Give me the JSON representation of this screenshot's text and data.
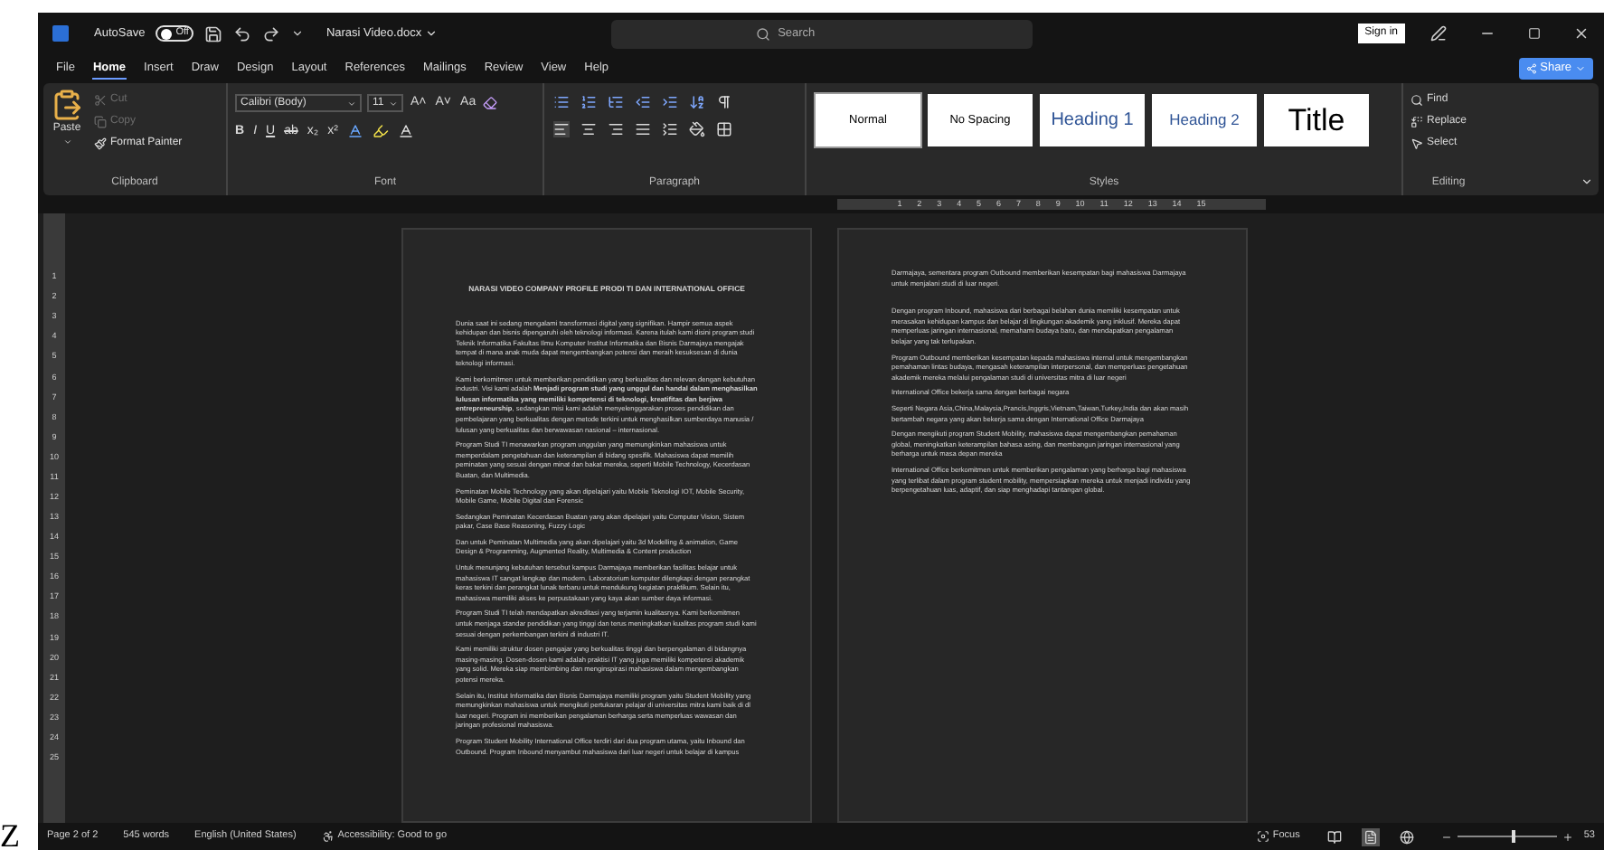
{
  "edge_fragment": "Z",
  "title_bar": {
    "autosave_label": "AutoSave",
    "autosave": {
      "on": false,
      "label": "Off"
    },
    "document_title": "Narasi Video.docx",
    "search": {
      "placeholder": "Search"
    },
    "sign_in": "Sign in"
  },
  "tabs": [
    {
      "label": "File",
      "selected": false
    },
    {
      "label": "Home",
      "selected": true
    },
    {
      "label": "Insert",
      "selected": false
    },
    {
      "label": "Draw",
      "selected": false
    },
    {
      "label": "Design",
      "selected": false
    },
    {
      "label": "Layout",
      "selected": false
    },
    {
      "label": "References",
      "selected": false
    },
    {
      "label": "Mailings",
      "selected": false
    },
    {
      "label": "Review",
      "selected": false
    },
    {
      "label": "View",
      "selected": false
    },
    {
      "label": "Help",
      "selected": false
    }
  ],
  "share": "Share",
  "ribbon": {
    "clipboard": {
      "paste": "Paste",
      "items": [
        {
          "label": "Cut",
          "disabled": true
        },
        {
          "label": "Copy",
          "disabled": true
        },
        {
          "label": "Format Painter",
          "disabled": false
        }
      ],
      "label": "Clipboard"
    },
    "font": {
      "family": "Calibri (Body)",
      "size": "11",
      "row1": [
        "A˄",
        "A˅",
        "Aa"
      ],
      "row2": [
        "B",
        "I",
        "U",
        "ab",
        "x₂",
        "x²"
      ],
      "label": "Font"
    },
    "paragraph": {
      "label": "Paragraph"
    },
    "styles": {
      "items": [
        {
          "label": "Normal",
          "kind": "normal",
          "selected": true
        },
        {
          "label": "No Spacing",
          "kind": "normal",
          "selected": false
        },
        {
          "label": "Heading 1",
          "kind": "heading1",
          "selected": false
        },
        {
          "label": "Heading 2",
          "kind": "heading2",
          "selected": false
        },
        {
          "label": "Title",
          "kind": "title",
          "selected": false
        }
      ],
      "label": "Styles"
    },
    "editing": {
      "items": [
        "Find",
        "Replace",
        "Select"
      ],
      "label": "Editing"
    }
  },
  "horizontal_ruler": [
    "1",
    "2",
    "3",
    "4",
    "5",
    "6",
    "7",
    "8",
    "9",
    "10",
    "11",
    "12",
    "13",
    "14",
    "15"
  ],
  "vertical_ruler": [
    "1",
    "2",
    "3",
    "4",
    "5",
    "6",
    "7",
    "8",
    "9",
    "10",
    "11",
    "12",
    "13",
    "14",
    "15",
    "16",
    "17",
    "18",
    "19",
    "20",
    "21",
    "22",
    "23",
    "24",
    "25"
  ],
  "pages": [
    {
      "title": "NARASI VIDEO COMPANY PROFILE PRODI TI DAN INTERNATIONAL OFFICE",
      "paragraphs": [
        "Dunia saat ini sedang mengalami transformasi digital yang signifikan. Hampir semua aspek kehidupan dan bisnis dipengaruhi oleh teknologi informasi. Karena itulah kami disini program studi Teknik Informatika Fakultas Ilmu Komputer Institut Informatika dan Bisnis Darmajaya mengajak tempat di mana anak muda dapat mengembangkan potensi dan meraih kesuksesan di dunia teknologi informasi.",
        "Kami berkomitmen untuk memberikan pendidikan yang berkualitas dan relevan dengan kebutuhan industri. Visi kami adalah **Menjadi program studi yang unggul dan handal dalam menghasilkan lulusan informatika yang memiliki kompetensi di teknologi, kreatifitas dan berjiwa entrepreneurship**, sedangkan misi kami adalah menyelenggarakan proses pendidikan dan pembelajaran yang berkualitas dengan metode terkini untuk menghasilkan sumberdaya manusia / lulusan yang berkualitas dan berwawasan nasional – internasional.",
        "Program Studi TI menawarkan program unggulan yang memungkinkan mahasiswa untuk memperdalam pengetahuan dan keterampilan di bidang spesifik. Mahasiswa dapat memilih peminatan yang sesuai dengan minat dan bakat mereka, seperti Mobile Technology, Kecerdasan Buatan, dan Multimedia.",
        "Peminatan Mobile Technology yang akan dipelajari yaitu Mobile Teknologi IOT, Mobile Security, Mobile Game, Mobile Digital dan Forensic",
        "Sedangkan Peminatan Kecerdasan Buatan yang akan dipelajari yaitu Computer Vision, Sistem pakar, Case Base Reasoning, Fuzzy Logic",
        "Dan untuk Peminatan Multimedia yang akan dipelajari yaitu 3d Modelling & animation, Game Design & Programming,   Augmented Reality, Multimedia & Content production",
        "Untuk menunjang kebutuhan tersebut kampus Darmajaya memberikan fasilitas belajar untuk mahasiswa IT sangat lengkap dan modern. Laboratorium komputer dilengkapi dengan perangkat keras terkini dan perangkat lunak terbaru untuk mendukung kegiatan praktikum. Selain itu, mahasiswa memiliki akses ke perpustakaan yang kaya akan sumber daya informasi.",
        "Program Studi TI telah mendapatkan akreditasi yang terjamin kualitasnya. Kami berkomitmen untuk menjaga standar pendidikan yang tinggi dan terus meningkatkan kualitas program studi kami sesuai dengan perkembangan terkini di industri IT.",
        "Kami memiliki struktur dosen pengajar yang berkualitas tinggi dan berpengalaman di bidangnya masing-masing. Dosen-dosen kami adalah praktisi IT yang juga memiliki kompetensi akademik yang solid. Mereka siap membimbing dan menginspirasi mahasiswa dalam mengembangkan potensi mereka.",
        "Selain itu, Institut Informatika dan Bisnis Darmajaya memiliki program yaitu Student Mobility yang memungkinkan mahasiswa untuk mengikuti pertukaran pelajar di universitas mitra kami baik di dl luar negeri. Program ini memberikan pengalaman berharga serta memperluas wawasan dan jaringan profesional mahasiswa.",
        "Program Student Mobility International Office terdiri dari dua program utama, yaitu Inbound dan Outbound. Program Inbound menyambut mahasiswa dari luar negeri untuk belajar di kampus"
      ]
    },
    {
      "paragraphs": [
        "Darmajaya, sementara program Outbound memberikan kesempatan bagi mahasiswa Darmajaya untuk menjalani studi di luar negeri.",
        "Dengan program Inbound, mahasiswa dari berbagai belahan dunia memiliki kesempatan untuk merasakan kehidupan kampus dan belajar di lingkungan akademik yang inklusif. Mereka dapat memperluas jaringan internasional, memahami budaya baru, dan mendapatkan pengalaman belajar yang tak terlupakan.",
        "Program Outbound memberikan kesempatan kepada mahasiswa internal untuk mengembangkan pemahaman lintas budaya, mengasah keterampilan interpersonal, dan memperluas pengetahuan akademik mereka melalui pengalaman studi di universitas mitra di luar negeri",
        "International Office bekerja sama dengan berbagai negara",
        "Seperti Negara Asia,China,Malaysia,Prancis,Inggris,Vietnam,Taiwan,Turkey,India dan akan masih bertambah negara yang akan bekerja sama dengan International Office Darmajaya",
        "Dengan mengikuti program Student Mobility, mahasiswa dapat mengembangkan pemahaman global, meningkatkan keterampilan bahasa asing, dan membangun jaringan internasional yang berharga untuk masa depan mereka",
        "International Office berkomitmen untuk memberikan pengalaman yang berharga bagi mahasiswa yang terlibat dalam program student mobility, mempersiapkan mereka untuk menjadi individu yang berpengetahuan luas, adaptif, dan siap menghadapi tantangan global."
      ]
    }
  ],
  "status_bar": {
    "page": "Page 2 of 2",
    "words": "545 words",
    "language": "English (United States)",
    "accessibility": "Accessibility: Good to go",
    "focus": "Focus",
    "views": [
      {
        "kind": "read",
        "selected": false
      },
      {
        "kind": "print",
        "selected": true
      },
      {
        "kind": "web",
        "selected": false
      }
    ],
    "zoom": {
      "level": 0.55,
      "label": "53"
    }
  }
}
